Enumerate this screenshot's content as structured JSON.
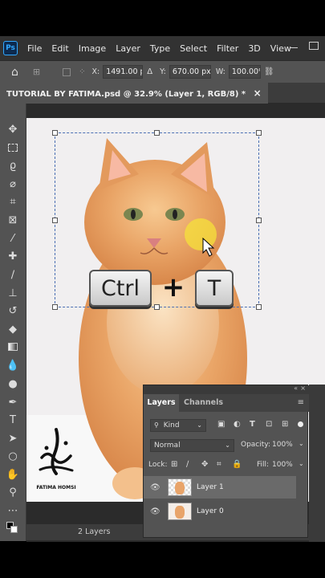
{
  "app": {
    "logo": "Ps",
    "menu": [
      "File",
      "Edit",
      "Image",
      "Layer",
      "Type",
      "Select",
      "Filter",
      "3D",
      "View"
    ]
  },
  "options": {
    "x_label": "X:",
    "x_value": "1491.00 p",
    "y_label": "Y:",
    "y_value": "670.00 px",
    "w_label": "W:",
    "w_value": "100.00%"
  },
  "document": {
    "tab_title": "TUTORIAL BY FATIMA.psd @ 32.9% (Layer 1, RGB/8) *",
    "close_glyph": "×"
  },
  "overlay": {
    "key1": "Ctrl",
    "plus": "+",
    "key2": "T"
  },
  "watermark": {
    "name": "FATIMA HOMSI"
  },
  "layers_panel": {
    "tab_layers": "Layers",
    "tab_channels": "Channels",
    "filter_kind": "Kind",
    "blend_mode": "Normal",
    "opacity_label": "Opacity:",
    "opacity_value": "100%",
    "lock_label": "Lock:",
    "fill_label": "Fill:",
    "fill_value": "100%",
    "layers": [
      {
        "name": "Layer 1",
        "selected": true
      },
      {
        "name": "Layer 0",
        "selected": false
      }
    ]
  },
  "status": {
    "layers_count": "2 Layers"
  },
  "colors": {
    "accent": "#31a8ff",
    "panel": "#535353",
    "canvas": "#f1eff0"
  }
}
